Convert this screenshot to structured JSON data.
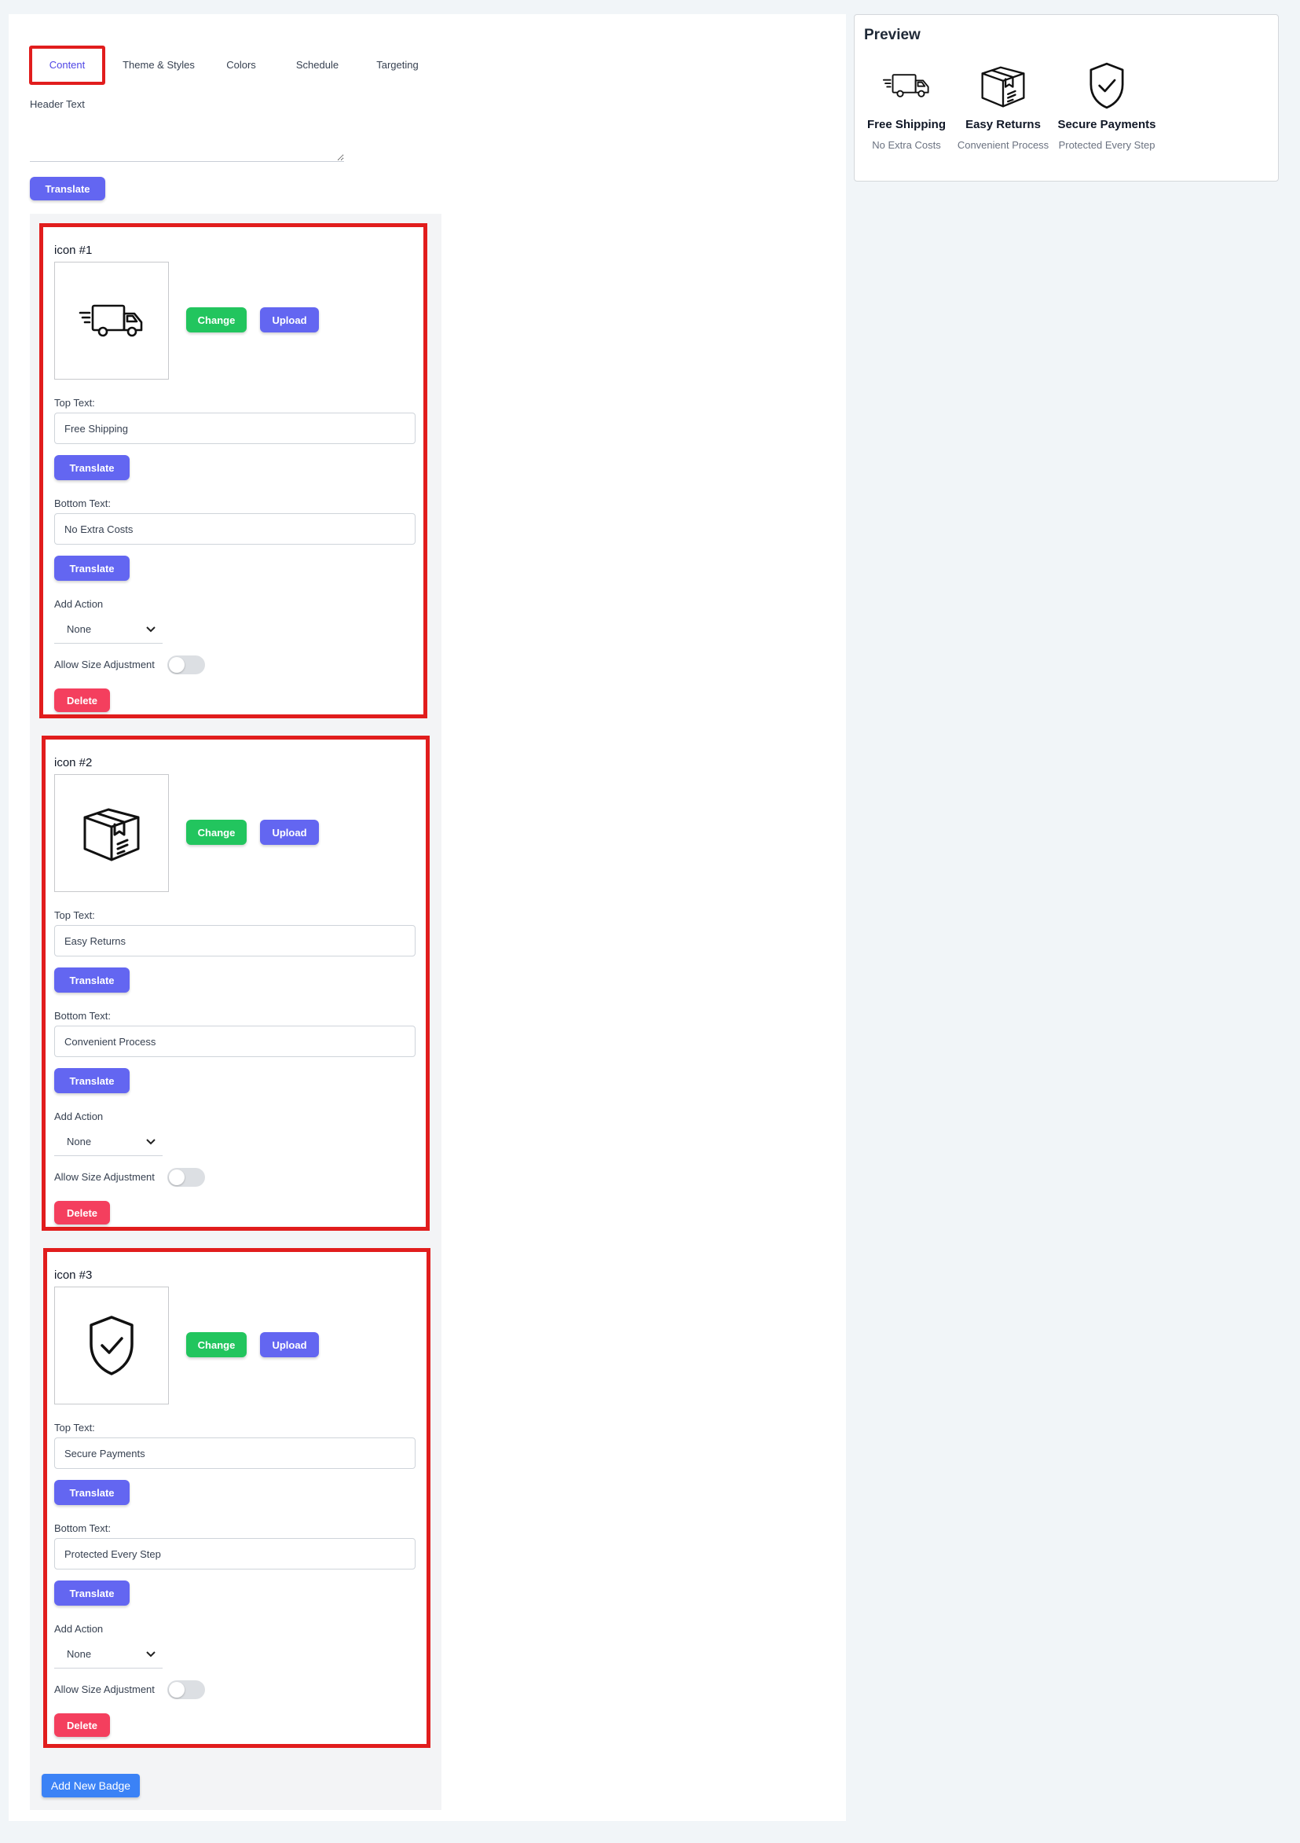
{
  "tabs": [
    {
      "label": "Content",
      "active": true
    },
    {
      "label": "Theme & Styles",
      "active": false
    },
    {
      "label": "Colors",
      "active": false
    },
    {
      "label": "Schedule",
      "active": false
    },
    {
      "label": "Targeting",
      "active": false
    }
  ],
  "header": {
    "label": "Header Text",
    "value": "",
    "translate_label": "Translate"
  },
  "badges": [
    {
      "title": "icon #1",
      "icon": "truck-icon",
      "change_label": "Change",
      "upload_label": "Upload",
      "top_text_label": "Top Text:",
      "top_text": "Free Shipping",
      "translate_label": "Translate",
      "bottom_text_label": "Bottom Text:",
      "bottom_text": "No Extra Costs",
      "action_label": "Add Action",
      "action_value": "None",
      "size_label": "Allow Size Adjustment",
      "size_enabled": false,
      "delete_label": "Delete"
    },
    {
      "title": "icon #2",
      "icon": "box-icon",
      "change_label": "Change",
      "upload_label": "Upload",
      "top_text_label": "Top Text:",
      "top_text": "Easy Returns",
      "translate_label": "Translate",
      "bottom_text_label": "Bottom Text:",
      "bottom_text": "Convenient Process",
      "action_label": "Add Action",
      "action_value": "None",
      "size_label": "Allow Size Adjustment",
      "size_enabled": false,
      "delete_label": "Delete"
    },
    {
      "title": "icon #3",
      "icon": "shield-check-icon",
      "change_label": "Change",
      "upload_label": "Upload",
      "top_text_label": "Top Text:",
      "top_text": "Secure Payments",
      "translate_label": "Translate",
      "bottom_text_label": "Bottom Text:",
      "bottom_text": "Protected Every Step",
      "action_label": "Add Action",
      "action_value": "None",
      "size_label": "Allow Size Adjustment",
      "size_enabled": false,
      "delete_label": "Delete"
    }
  ],
  "add_badge_label": "Add New Badge",
  "preview": {
    "title": "Preview",
    "items": [
      {
        "icon": "truck-icon",
        "top": "Free Shipping",
        "bottom": "No Extra Costs"
      },
      {
        "icon": "box-icon",
        "top": "Easy Returns",
        "bottom": "Convenient Process"
      },
      {
        "icon": "shield-check-icon",
        "top": "Secure Payments",
        "bottom": "Protected Every Step"
      }
    ]
  },
  "colors": {
    "accent": "#6366f1",
    "change": "#22c55e",
    "delete": "#f43f5e",
    "add_badge": "#3b82f6",
    "highlight": "#e11d1d"
  }
}
